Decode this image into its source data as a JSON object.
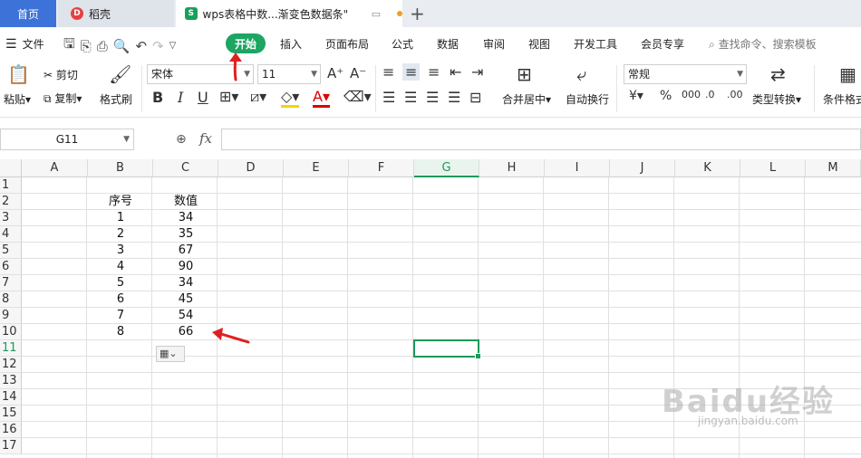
{
  "tabs": {
    "home": "首页",
    "daoke": "稻壳",
    "doc_title": "wps表格中数...渐变色数据条\"",
    "add": "+"
  },
  "menu": {
    "file": "文件",
    "start": "开始",
    "items": [
      "插入",
      "页面布局",
      "公式",
      "数据",
      "审阅",
      "视图",
      "开发工具",
      "会员专享"
    ],
    "search": "查找命令、搜索模板"
  },
  "ribbon": {
    "paste": "粘贴",
    "cut": "剪切",
    "copy": "复制",
    "format_painter": "格式刷",
    "font_name": "宋体",
    "font_size": "11",
    "merge_center": "合并居中",
    "wrap_text": "自动换行",
    "number_format": "常规",
    "type_convert": "类型转换",
    "conditional_format": "条件格式"
  },
  "formula_bar": {
    "cell_ref": "G11",
    "fx": "fx",
    "value": ""
  },
  "sheet": {
    "columns": [
      "A",
      "B",
      "C",
      "D",
      "E",
      "F",
      "G",
      "H",
      "I",
      "J",
      "K",
      "L",
      "M"
    ],
    "rows": [
      "1",
      "2",
      "3",
      "4",
      "5",
      "6",
      "7",
      "8",
      "9",
      "10",
      "11",
      "12",
      "13",
      "14",
      "15",
      "16",
      "17"
    ],
    "selected_column": "G",
    "selected_row": "11",
    "header_seq": "序号",
    "header_value": "数值",
    "data": [
      {
        "seq": "1",
        "value": "34"
      },
      {
        "seq": "2",
        "value": "35"
      },
      {
        "seq": "3",
        "value": "67"
      },
      {
        "seq": "4",
        "value": "90"
      },
      {
        "seq": "5",
        "value": "34"
      },
      {
        "seq": "6",
        "value": "45"
      },
      {
        "seq": "7",
        "value": "54"
      },
      {
        "seq": "8",
        "value": "66"
      }
    ]
  },
  "watermark": {
    "brand": "Baidu经验",
    "url": "jingyan.baidu.com"
  },
  "colors": {
    "accent_green": "#1ca563",
    "home_tab_blue": "#3d73d9",
    "annotation_red": "#e02020"
  }
}
